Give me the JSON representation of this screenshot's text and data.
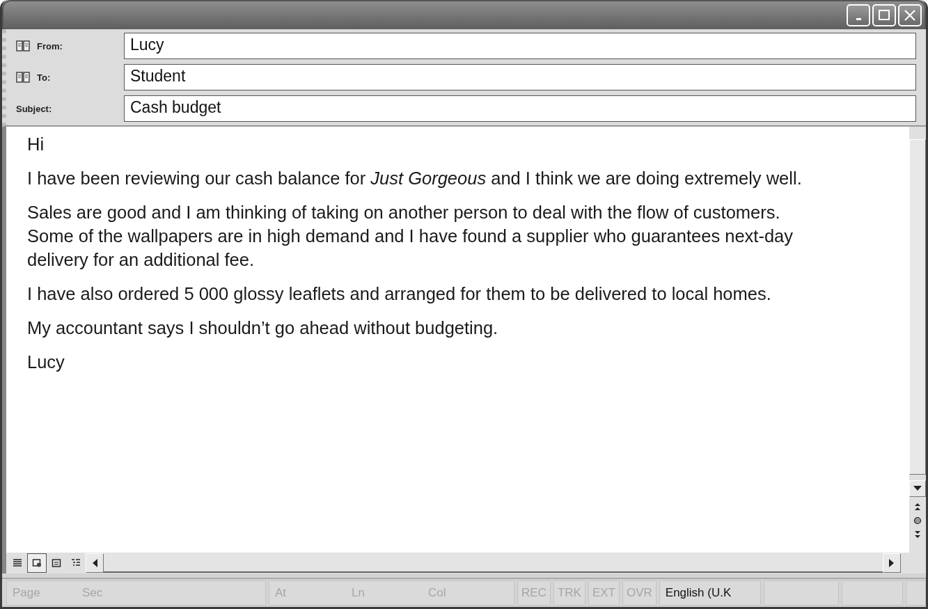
{
  "header": [
    {
      "kind": "address",
      "label": "From:",
      "value": "Lucy"
    },
    {
      "kind": "address",
      "label": "To:",
      "value": "Student"
    },
    {
      "kind": "plain",
      "label": "Subject:",
      "value": "Cash budget"
    }
  ],
  "body": [
    "Hi",
    "I have been reviewing our cash balance for *Just Gorgeous* and I think we are doing extremely well.",
    "Sales are good and I am thinking of taking on another person to deal with the flow of customers. Some of the wallpapers are in high demand and I have found a supplier who guarantees next-day delivery for an additional fee.",
    "I have also ordered 5 000 glossy leaflets and arranged for them to be delivered to local homes.",
    "My accountant says I shouldn’t go ahead without budgeting.",
    "Lucy"
  ],
  "view_buttons": [
    {
      "kind": "normal",
      "selected": false
    },
    {
      "kind": "web",
      "selected": true
    },
    {
      "kind": "print",
      "selected": false
    },
    {
      "kind": "outline",
      "selected": false
    }
  ],
  "status_bar": [
    {
      "text": "Page",
      "disabled": true
    },
    {
      "text": "Sec",
      "disabled": true
    },
    {
      "text": "At",
      "disabled": true
    },
    {
      "text": "Ln",
      "disabled": true
    },
    {
      "text": "Col",
      "disabled": true
    },
    {
      "text": "REC",
      "disabled": true
    },
    {
      "text": "TRK",
      "disabled": true
    },
    {
      "text": "EXT",
      "disabled": true
    },
    {
      "text": "OVR",
      "disabled": true
    },
    {
      "text": "English (U.K",
      "disabled": false
    }
  ]
}
